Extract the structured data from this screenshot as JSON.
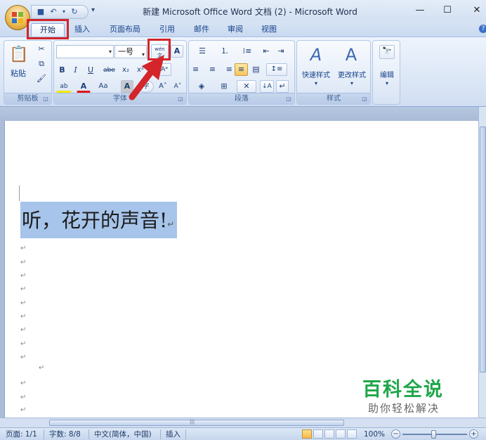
{
  "window": {
    "title": "新建 Microsoft Office Word 文档 (2) - Microsoft Word",
    "min_icon": "—",
    "max_icon": "☐",
    "close_icon": "✕"
  },
  "qat": {
    "save_icon": "■",
    "undo_icon": "↶",
    "undo_dd": "▾",
    "redo_icon": "↻",
    "more_icon": "▾"
  },
  "tabs": [
    {
      "label": "开始",
      "active": true
    },
    {
      "label": "插入"
    },
    {
      "label": "页面布局"
    },
    {
      "label": "引用"
    },
    {
      "label": "邮件"
    },
    {
      "label": "审阅"
    },
    {
      "label": "视图"
    }
  ],
  "help_icon": "?",
  "ribbon": {
    "clipboard": {
      "label": "剪贴板",
      "paste_label": "粘贴",
      "paste_icon": "📋",
      "cut_icon": "✂",
      "copy_icon": "⧉",
      "format_painter_icon": "🖌"
    },
    "font": {
      "label": "字体",
      "font_name_value": "",
      "font_size_value": "一号",
      "phonetic_icon": "wén 文",
      "char_border_icon": "A",
      "bold": "B",
      "italic": "I",
      "underline": "U",
      "strike": "abe",
      "subscript": "x₂",
      "superscript": "x²",
      "clear_format_icon": "Aᵃ",
      "highlight": "ab",
      "font_color": "A",
      "change_case": "Aa",
      "char_shading": "A",
      "enclose_char": "字",
      "grow_font": "A˄",
      "shrink_font": "A˅"
    },
    "paragraph": {
      "label": "段落",
      "bullets_icon": "☰",
      "numbering_icon": "⒈",
      "multilevel_icon": "⁞≡",
      "decrease_indent_icon": "⇤",
      "increase_indent_icon": "⇥",
      "align_left": "≡",
      "align_center": "≡",
      "align_right": "≡",
      "justify": "≡",
      "distribute": "▤",
      "line_spacing": "↕≡",
      "shading": "◈",
      "borders": "⊞",
      "chinese_layout": "✕",
      "sort": "↓A",
      "show_marks": "↵"
    },
    "styles": {
      "label": "样式",
      "quick_styles": "快速样式",
      "change_styles": "更改样式"
    },
    "editing": {
      "label": "编辑",
      "icon": "🔭"
    }
  },
  "document": {
    "heading_text": "听，花开的声音!",
    "para_mark": "↵"
  },
  "watermark": {
    "title": "百科全说",
    "subtitle": "助你轻松解决"
  },
  "statusbar": {
    "page": "页面: 1/1",
    "words": "字数: 8/8",
    "language": "中文(简体，中国)",
    "mode": "插入",
    "zoom": "100%",
    "zoom_out": "−",
    "zoom_in": "+"
  },
  "colors": {
    "annotation_red": "#d3252a",
    "selection": "#a7c4ea",
    "watermark_green": "#1fa64a"
  }
}
